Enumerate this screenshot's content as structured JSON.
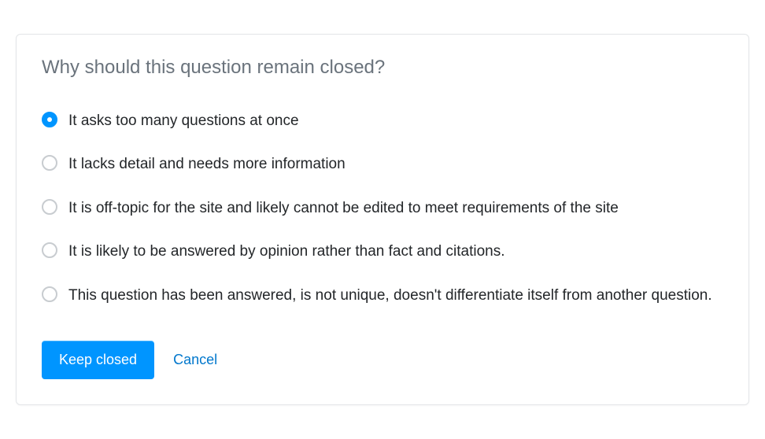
{
  "dialog": {
    "title": "Why should this question remain closed?",
    "options": [
      {
        "label": "It asks too many questions at once",
        "selected": true
      },
      {
        "label": "It lacks detail and needs more information",
        "selected": false
      },
      {
        "label": "It is off-topic for the site and likely cannot be edited to meet requirements of the site",
        "selected": false
      },
      {
        "label": "It is likely to be answered by opinion rather than fact and citations.",
        "selected": false
      },
      {
        "label": "This question has been answered, is not unique, doesn't differentiate itself from another question.",
        "selected": false
      }
    ],
    "actions": {
      "primary": "Keep closed",
      "cancel": "Cancel"
    }
  }
}
